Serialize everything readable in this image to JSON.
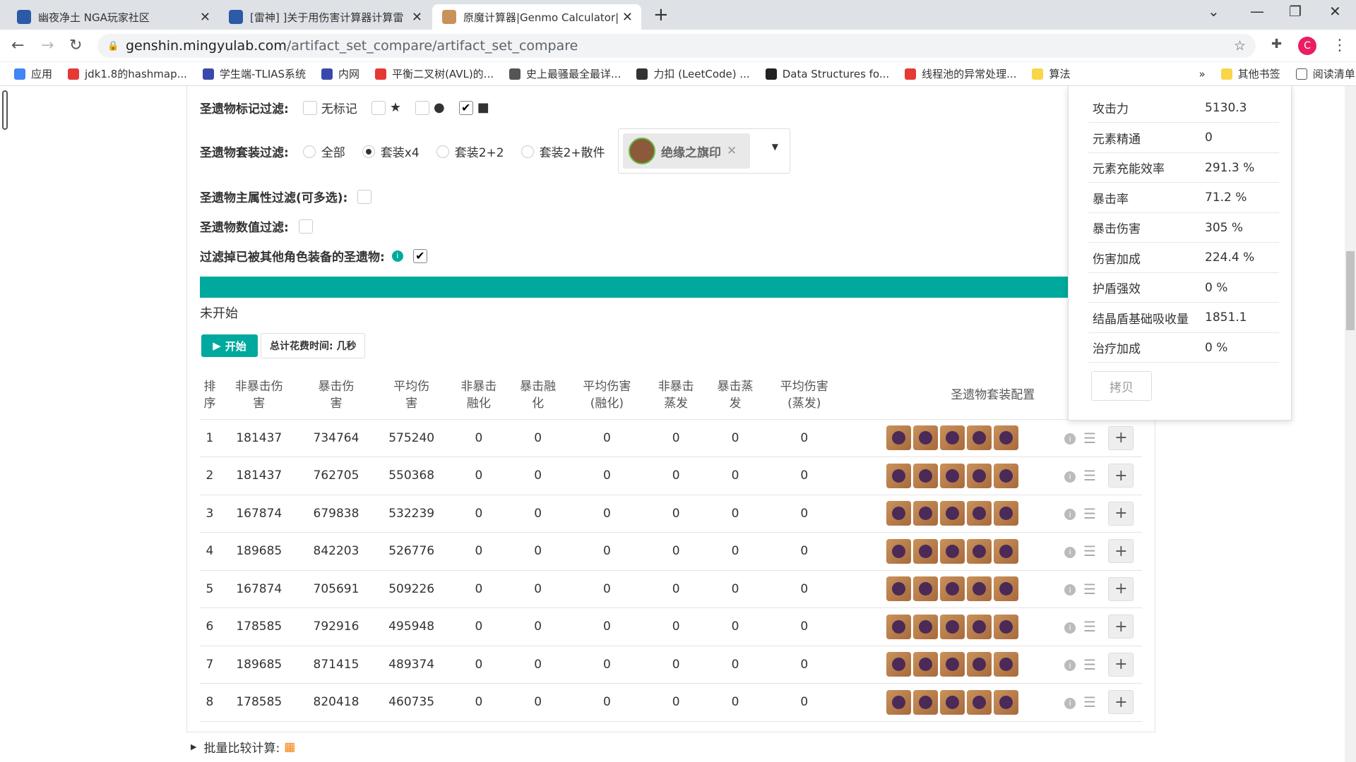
{
  "tabs": [
    {
      "title": "幽夜净土 NGA玩家社区"
    },
    {
      "title": "[雷神] ]关于用伤害计算器计算雷"
    },
    {
      "title": "原魔计算器|Genmo Calculator|"
    }
  ],
  "address": {
    "host": "genshin.mingyulab.com",
    "path": "/artifact_set_compare/artifact_set_compare",
    "avatar": "C"
  },
  "bookmarks": [
    "应用",
    "jdk1.8的hashmap...",
    "学生端-TLIAS系统",
    "内网",
    "平衡二叉树(AVL)的...",
    "史上最骚最全最详...",
    "力扣 (LeetCode) ...",
    "Data Structures fo...",
    "线程池的异常处理...",
    "算法",
    "其他书签",
    "阅读清单"
  ],
  "filters": {
    "mark_label": "圣遗物标记过滤:",
    "mark_none": "无标记",
    "set_label": "圣遗物套装过滤:",
    "set_options": [
      "全部",
      "套装x4",
      "套装2+2",
      "套装2+散件"
    ],
    "set_selected": "套装x4",
    "set_chip": "绝缘之旗印",
    "main_label": "圣遗物主属性过滤(可多选):",
    "value_label": "圣遗物数值过滤:",
    "equipped_label": "过滤掉已被其他角色装备的圣遗物:"
  },
  "status": "未开始",
  "buttons": {
    "start": "开始",
    "time": "总计花费时间: 几秒",
    "copy": "拷贝"
  },
  "table": {
    "headers": [
      "排\n序",
      "非暴击伤\n害",
      "暴击伤\n害",
      "平均伤\n害",
      "非暴击\n融化",
      "暴击融\n化",
      "平均伤害\n(融化)",
      "非暴击\n蒸发",
      "暴击蒸\n发",
      "平均伤害\n(蒸发)",
      "圣遗物套装配置"
    ],
    "rows": [
      [
        "1",
        "181437",
        "734764",
        "575240",
        "0",
        "0",
        "0",
        "0",
        "0",
        "0"
      ],
      [
        "2",
        "181437",
        "762705",
        "550368",
        "0",
        "0",
        "0",
        "0",
        "0",
        "0"
      ],
      [
        "3",
        "167874",
        "679838",
        "532239",
        "0",
        "0",
        "0",
        "0",
        "0",
        "0"
      ],
      [
        "4",
        "189685",
        "842203",
        "526776",
        "0",
        "0",
        "0",
        "0",
        "0",
        "0"
      ],
      [
        "5",
        "167874",
        "705691",
        "509226",
        "0",
        "0",
        "0",
        "0",
        "0",
        "0"
      ],
      [
        "6",
        "178585",
        "792916",
        "495948",
        "0",
        "0",
        "0",
        "0",
        "0",
        "0"
      ],
      [
        "7",
        "189685",
        "871415",
        "489374",
        "0",
        "0",
        "0",
        "0",
        "0",
        "0"
      ],
      [
        "8",
        "178585",
        "820418",
        "460735",
        "0",
        "0",
        "0",
        "0",
        "0",
        "0"
      ]
    ]
  },
  "batch": "批量比较计算:",
  "stats": [
    {
      "k": "攻击力",
      "v": "5130.3"
    },
    {
      "k": "元素精通",
      "v": "0"
    },
    {
      "k": "元素充能效率",
      "v": "291.3 %"
    },
    {
      "k": "暴击率",
      "v": "71.2 %"
    },
    {
      "k": "暴击伤害",
      "v": "305 %"
    },
    {
      "k": "伤害加成",
      "v": "224.4 %"
    },
    {
      "k": "护盾强效",
      "v": "0 %"
    },
    {
      "k": "结晶盾基础吸收量",
      "v": "1851.1"
    },
    {
      "k": "治疗加成",
      "v": "0 %"
    }
  ]
}
